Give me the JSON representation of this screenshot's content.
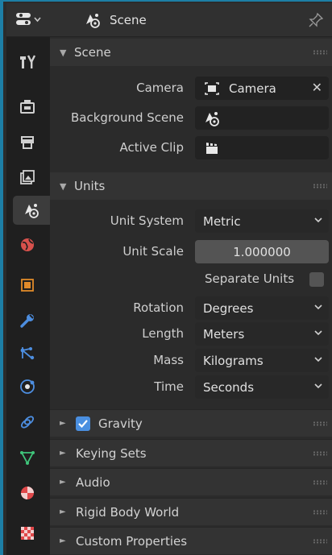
{
  "header": {
    "title": "Scene",
    "editor_icon": "properties-editor-icon",
    "pin_icon": "pin-icon"
  },
  "tabs": [
    {
      "name": "tool",
      "icon": "tool-settings-icon",
      "color": "#d0d0d0"
    },
    {
      "name": "render",
      "icon": "render-camera-icon",
      "color": "#d0d0d0"
    },
    {
      "name": "output",
      "icon": "output-printer-icon",
      "color": "#d0d0d0"
    },
    {
      "name": "view-layer",
      "icon": "view-layer-icon",
      "color": "#d0d0d0"
    },
    {
      "name": "scene",
      "icon": "scene-icon",
      "color": "#d0d0d0",
      "active": true
    },
    {
      "name": "world",
      "icon": "world-icon",
      "color": "#d8514c"
    },
    {
      "name": "object",
      "icon": "object-icon",
      "color": "#e08a2a"
    },
    {
      "name": "modifiers",
      "icon": "wrench-icon",
      "color": "#4d8ee0"
    },
    {
      "name": "particles",
      "icon": "particles-icon",
      "color": "#4d8ee0"
    },
    {
      "name": "physics",
      "icon": "physics-icon",
      "color": "#4d8ee0"
    },
    {
      "name": "constraints",
      "icon": "constraints-icon",
      "color": "#4d8ee0"
    },
    {
      "name": "data",
      "icon": "mesh-data-icon",
      "color": "#3fc47a"
    },
    {
      "name": "material",
      "icon": "material-icon",
      "color": "#e0484a"
    },
    {
      "name": "texture",
      "icon": "texture-icon",
      "color": "#e0484a"
    }
  ],
  "scene_panel": {
    "title": "Scene",
    "camera_label": "Camera",
    "camera_value": "Camera",
    "background_label": "Background Scene",
    "clip_label": "Active Clip"
  },
  "units_panel": {
    "title": "Units",
    "unit_system_label": "Unit System",
    "unit_system_value": "Metric",
    "unit_scale_label": "Unit Scale",
    "unit_scale_value": "1.000000",
    "separate_units_label": "Separate Units",
    "rotation_label": "Rotation",
    "rotation_value": "Degrees",
    "length_label": "Length",
    "length_value": "Meters",
    "mass_label": "Mass",
    "mass_value": "Kilograms",
    "time_label": "Time",
    "time_value": "Seconds"
  },
  "collapsed_panels": {
    "gravity": "Gravity",
    "keying_sets": "Keying Sets",
    "audio": "Audio",
    "rigid_body_world": "Rigid Body World",
    "custom_properties": "Custom Properties"
  }
}
